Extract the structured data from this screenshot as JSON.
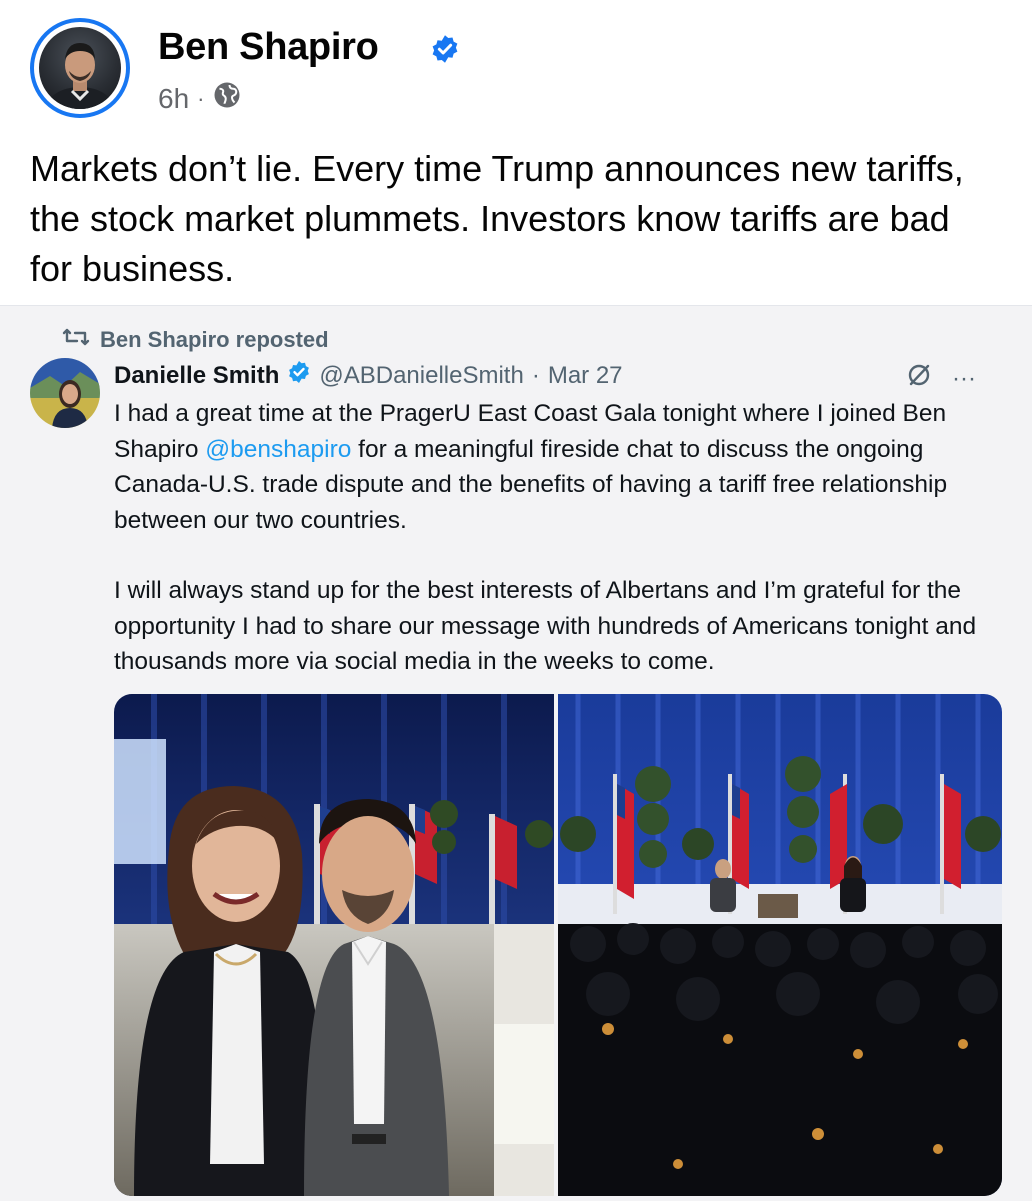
{
  "post": {
    "author": "Ben Shapiro",
    "time": "6h",
    "separator": "·",
    "text": "Markets don’t lie. Every time Trump announces new tariffs, the stock market plummets. Investors know tariffs are bad for business."
  },
  "embed": {
    "repost_label": "Ben Shapiro reposted",
    "tweet": {
      "name": "Danielle Smith",
      "handle": "@ABDanielleSmith",
      "separator": "·",
      "date": "Mar 27",
      "more": "···",
      "para1_before": "I had a great time at the PragerU East Coast Gala tonight where I joined Ben Shapiro ",
      "para1_mention": "@benshapiro",
      "para1_after": " for a meaningful fireside chat to discuss the ongoing Canada-U.S. trade dispute and the benefits of having a tariff free relationship between our two countries.",
      "para2": "I will always stand up for the best interests of Albertans and I’m grateful for the opportunity I had to share our message with hundreds of Americans tonight and thousands more via social media in the weeks to come."
    }
  },
  "colors": {
    "fb_blue": "#1877f2",
    "twitter_blue": "#1d9bf0",
    "muted_text": "#65676b"
  },
  "icons": [
    "verified-badge-icon",
    "globe-icon",
    "repost-icon",
    "grok-icon",
    "more-icon"
  ]
}
